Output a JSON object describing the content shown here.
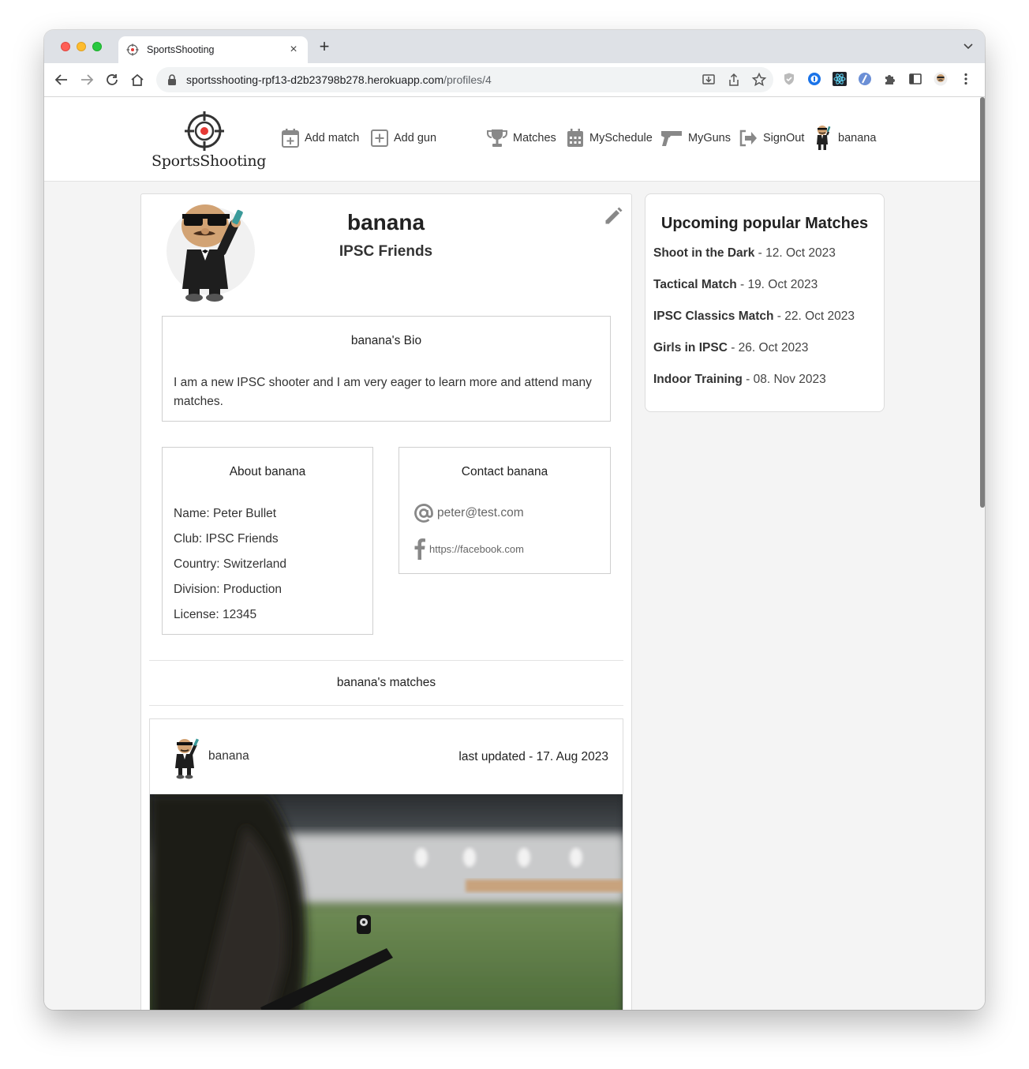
{
  "browser": {
    "tab_title": "SportsShooting",
    "url_host": "sportsshooting-rpf13-d2b23798b278.herokuapp.com",
    "url_path": "/profiles/4"
  },
  "nav": {
    "brand": "SportsShooting",
    "add_match": "Add match",
    "add_gun": "Add gun",
    "matches": "Matches",
    "myschedule": "MySchedule",
    "myguns": "MyGuns",
    "signout": "SignOut",
    "user": "banana"
  },
  "profile": {
    "name": "banana",
    "club": "IPSC Friends",
    "bio_title": "banana's Bio",
    "bio_text": "I am a new IPSC shooter and I am very eager to learn more and attend many matches.",
    "about_title": "About banana",
    "about": [
      "Name: Peter Bullet",
      "Club: IPSC Friends",
      "Country: Switzerland",
      "Division: Production",
      "License: 12345"
    ],
    "contact_title": "Contact banana",
    "email": "peter@test.com",
    "facebook": "https://facebook.com",
    "matches_title": "banana's matches"
  },
  "match_card": {
    "owner": "banana",
    "updated": "last updated - 17. Aug 2023"
  },
  "upcoming": {
    "title": "Upcoming popular Matches",
    "items": [
      {
        "name": "Shoot in the Dark",
        "date": " - 12. Oct 2023"
      },
      {
        "name": "Tactical Match",
        "date": " - 19. Oct 2023"
      },
      {
        "name": "IPSC Classics Match",
        "date": " - 22. Oct 2023"
      },
      {
        "name": "Girls in IPSC",
        "date": " - 26. Oct 2023"
      },
      {
        "name": "Indoor Training",
        "date": " - 08. Nov 2023"
      }
    ]
  },
  "colors": {
    "page_bg": "#f4f4f4",
    "logo_red": "#e53935",
    "icon_gray": "#8a8a8a"
  }
}
